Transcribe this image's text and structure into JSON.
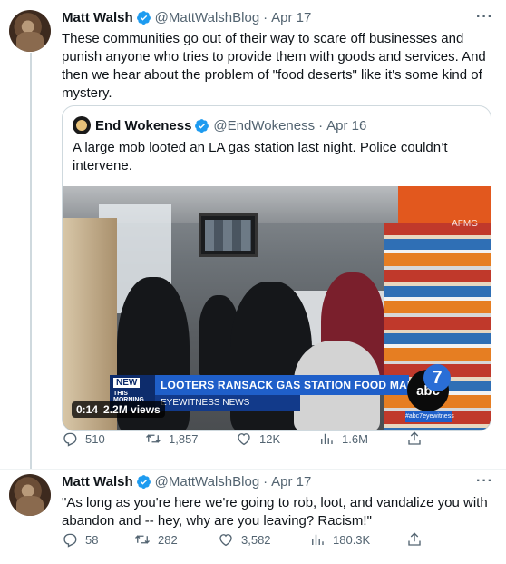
{
  "tweet1": {
    "name": "Matt Walsh",
    "handle": "@MattWalshBlog",
    "dot": "·",
    "date": "Apr 17",
    "text": "These communities go out of their way to scare off businesses and punish anyone who tries to provide them with goods and services. And then we hear about the problem of \"food deserts\" like it's some kind of mystery.",
    "more": "···",
    "quoted": {
      "name": "End Wokeness",
      "handle": "@EndWokeness",
      "dot": "·",
      "date": "Apr 16",
      "text": "A large mob looted an LA gas station last night. Police couldn’t intervene.",
      "video": {
        "duration": "0:14",
        "views": "2.2M views",
        "watermark": "AFMG",
        "news_badge_new": "NEW",
        "news_badge_sub": "THIS MORNING",
        "headline": "LOOTERS RANSACK GAS STATION FOOD MART",
        "subheadline": "EYEWITNESS NEWS",
        "logo_text": "abc",
        "logo_number": "7",
        "logo_tag": "#abc7eyewitness"
      }
    },
    "stats": {
      "replies": "510",
      "retweets": "1,857",
      "likes": "12K",
      "views": "1.6M"
    }
  },
  "tweet2": {
    "name": "Matt Walsh",
    "handle": "@MattWalshBlog",
    "dot": "·",
    "date": "Apr 17",
    "text": "\"As long as you're here we're going to rob, loot, and vandalize you with abandon and -- hey, why are you leaving? Racism!\"",
    "more": "···",
    "stats": {
      "replies": "58",
      "retweets": "282",
      "likes": "3,582",
      "views": "180.3K"
    }
  },
  "icons": [
    "verified-badge-icon",
    "reply-icon",
    "retweet-icon",
    "like-icon",
    "views-icon",
    "share-icon",
    "more-icon"
  ],
  "colors": {
    "verified": "#1d9bf0",
    "secondary_text": "#536471",
    "border": "#cfd9de",
    "text": "#0f1419"
  }
}
